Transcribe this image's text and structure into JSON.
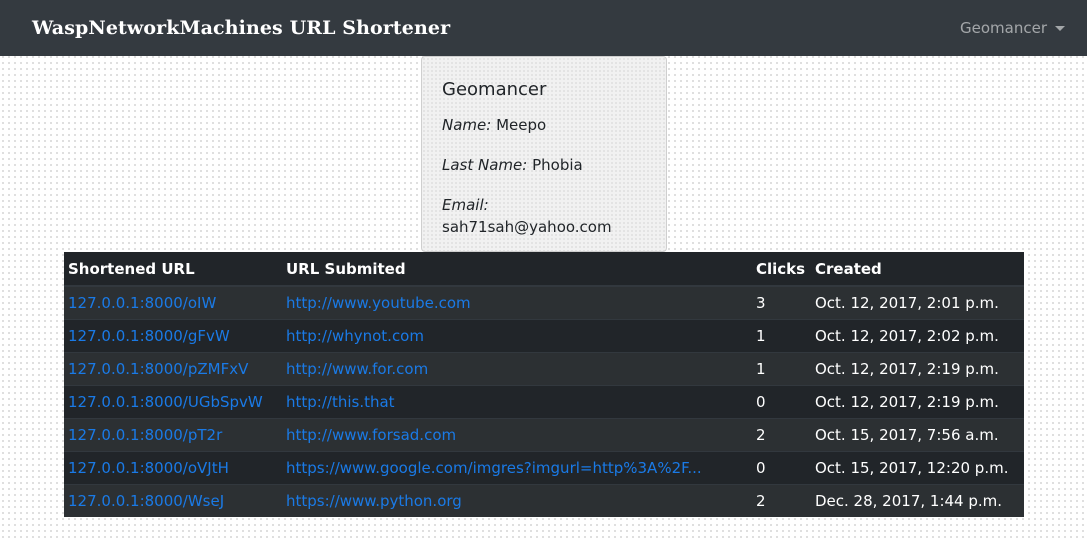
{
  "header": {
    "brand": "WaspNetworkMachines URL Shortener",
    "user_menu_label": "Geomancer"
  },
  "profile": {
    "username": "Geomancer",
    "name_label": "Name:",
    "name_value": "Meepo",
    "last_name_label": "Last Name:",
    "last_name_value": "Phobia",
    "email_label": "Email:",
    "email_value": "sah71sah@yahoo.com"
  },
  "table": {
    "columns": [
      "Shortened URL",
      "URL Submited",
      "Clicks",
      "Created"
    ],
    "rows": [
      {
        "short": "127.0.0.1:8000/oIW",
        "submitted": "http://www.youtube.com",
        "clicks": "3",
        "created": "Oct. 12, 2017, 2:01 p.m."
      },
      {
        "short": "127.0.0.1:8000/gFvW",
        "submitted": "http://whynot.com",
        "clicks": "1",
        "created": "Oct. 12, 2017, 2:02 p.m."
      },
      {
        "short": "127.0.0.1:8000/pZMFxV",
        "submitted": "http://www.for.com",
        "clicks": "1",
        "created": "Oct. 12, 2017, 2:19 p.m."
      },
      {
        "short": "127.0.0.1:8000/UGbSpvW",
        "submitted": "http://this.that",
        "clicks": "0",
        "created": "Oct. 12, 2017, 2:19 p.m."
      },
      {
        "short": "127.0.0.1:8000/pT2r",
        "submitted": "http://www.forsad.com",
        "clicks": "2",
        "created": "Oct. 15, 2017, 7:56 a.m."
      },
      {
        "short": "127.0.0.1:8000/oVJtH",
        "submitted": "https://www.google.com/imgres?imgurl=http%3A%2F...",
        "clicks": "0",
        "created": "Oct. 15, 2017, 12:20 p.m."
      },
      {
        "short": "127.0.0.1:8000/WseJ",
        "submitted": "https://www.python.org",
        "clicks": "2",
        "created": "Dec. 28, 2017, 1:44 p.m."
      }
    ]
  },
  "colors": {
    "navbar_bg": "#343a40",
    "table_bg": "#212529",
    "link": "#1a7ae6"
  }
}
